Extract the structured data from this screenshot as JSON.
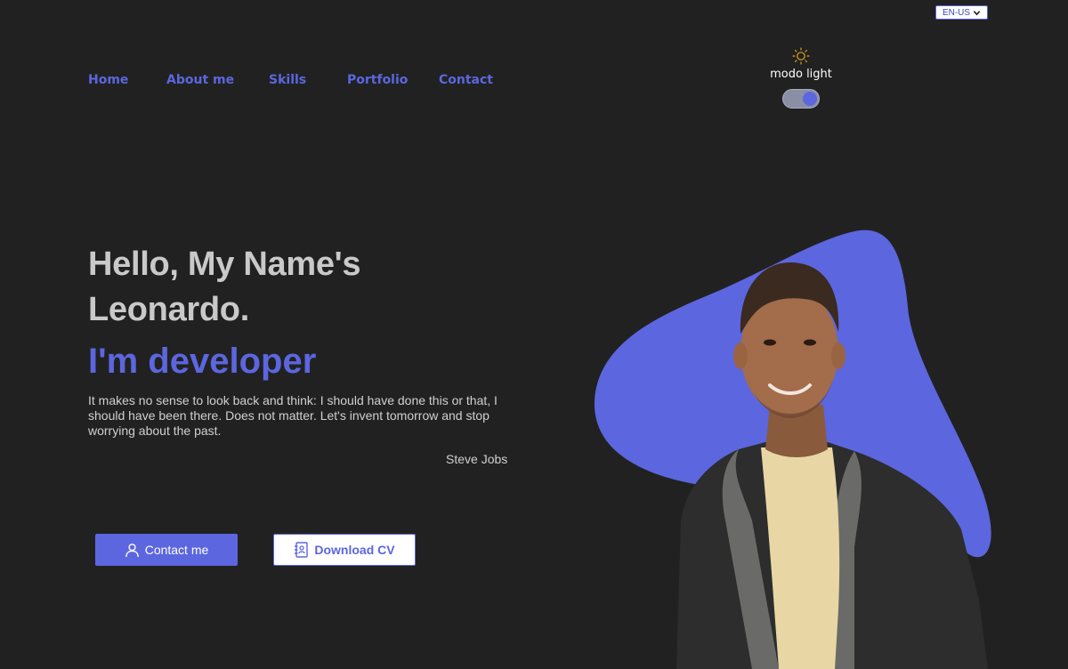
{
  "language": {
    "selected": "EN-US"
  },
  "nav": {
    "items": [
      {
        "label": "Home"
      },
      {
        "label": "About me"
      },
      {
        "label": "Skills"
      },
      {
        "label": "Portfolio"
      },
      {
        "label": "Contact"
      }
    ]
  },
  "theme": {
    "icon": "sun-icon",
    "label": "modo light",
    "toggle_on": true
  },
  "hero": {
    "title": "Hello, My Name's Leonardo.",
    "role": "I'm developer",
    "quote": "It makes no sense to look back and think: I should have done this or that, I should have been there. Does not matter. Let's invent tomorrow and stop worrying about the past.",
    "author": "Steve Jobs"
  },
  "buttons": {
    "contact": {
      "label": "Contact me",
      "icon": "user-icon"
    },
    "download": {
      "label": "Download CV",
      "icon": "contact-book-icon"
    }
  },
  "colors": {
    "background": "#212121",
    "accent": "#5c66df",
    "heading": "#c9c9c9",
    "text": "#d0d0d0"
  }
}
